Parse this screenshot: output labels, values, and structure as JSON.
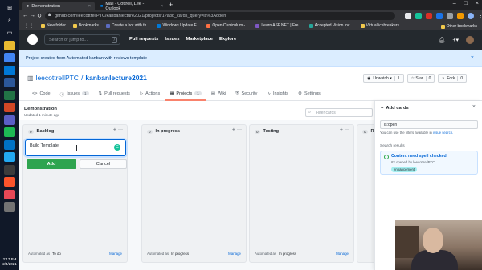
{
  "taskbar": {
    "icons": [
      {
        "name": "windows-start-icon",
        "color": "#101828",
        "glyph": "⊞"
      },
      {
        "name": "search-icon",
        "color": "#101828",
        "glyph": "⌕"
      },
      {
        "name": "task-view-icon",
        "color": "#101828",
        "glyph": "▭"
      },
      {
        "name": "file-explorer-icon",
        "color": "#e8b931",
        "glyph": ""
      },
      {
        "name": "chrome-icon",
        "color": "#4285f4",
        "glyph": ""
      },
      {
        "name": "edge-icon",
        "color": "#0078d7",
        "glyph": ""
      },
      {
        "name": "word-icon",
        "color": "#2b579a",
        "glyph": ""
      },
      {
        "name": "excel-icon",
        "color": "#217346",
        "glyph": ""
      },
      {
        "name": "powerpoint-icon",
        "color": "#d24726",
        "glyph": ""
      },
      {
        "name": "teams-icon",
        "color": "#5b5fc7",
        "glyph": ""
      },
      {
        "name": "spotify-icon",
        "color": "#1db954",
        "glyph": ""
      },
      {
        "name": "outlook-icon",
        "color": "#0072c6",
        "glyph": ""
      },
      {
        "name": "vscode-icon",
        "color": "#23a9f2",
        "glyph": ""
      },
      {
        "name": "terminal-icon",
        "color": "#3c3c3c",
        "glyph": ""
      },
      {
        "name": "brave-icon",
        "color": "#fb542b",
        "glyph": ""
      },
      {
        "name": "app-icon",
        "color": "#e74856",
        "glyph": ""
      },
      {
        "name": "settings-icon",
        "color": "#737373",
        "glyph": ""
      }
    ],
    "time": "2:17 PM",
    "date": "2/4/2021"
  },
  "browser": {
    "tabs": [
      {
        "title": "Demonstration",
        "active": true,
        "close": "×"
      },
      {
        "title": "Mail - Cottrell, Lee - Outlook",
        "active": false,
        "close": "×"
      }
    ],
    "new_tab": "+",
    "address": "github.com/leecottrellPTC/kanbanlecture2021/projects/1?add_cards_query=is%3Aopen",
    "bookmarks": [
      {
        "label": "New folder",
        "color": "#f2c94c"
      },
      {
        "label": "Bookmarks",
        "color": "#f2c94c"
      },
      {
        "label": "Create a bot with th...",
        "color": "#5c6bc0"
      },
      {
        "label": "Windows Update F...",
        "color": "#0078d7"
      },
      {
        "label": "Open Curriculum -...",
        "color": "#ff7043"
      },
      {
        "label": "Learn ASP.NET | Fre...",
        "color": "#7e57c2"
      },
      {
        "label": "Accepted Vision Inc...",
        "color": "#26a69a"
      },
      {
        "label": "Virtual icebreakers",
        "color": "#f2c94c"
      }
    ],
    "other_bookmarks": "Other bookmarks"
  },
  "github": {
    "search_placeholder": "Search or jump to...",
    "search_key": "/",
    "nav": [
      "Pull requests",
      "Issues",
      "Marketplace",
      "Explore"
    ],
    "flash": "Project created from Automated kanban with reviews template",
    "owner": "leecottrellPTC",
    "separator": "/",
    "repo": "kanbanlecture2021",
    "actions": [
      {
        "label": "Unwatch ▾",
        "count": "1"
      },
      {
        "label": "☆ Star",
        "count": "0"
      },
      {
        "label": "Fork",
        "count": "0"
      }
    ],
    "tabs": [
      {
        "label": "Code",
        "icon": "<>",
        "badge": ""
      },
      {
        "label": "Issues",
        "icon": "ⓘ",
        "badge": "1"
      },
      {
        "label": "Pull requests",
        "icon": "⇅",
        "badge": ""
      },
      {
        "label": "Actions",
        "icon": "▷",
        "badge": ""
      },
      {
        "label": "Projects",
        "icon": "▦",
        "badge": "1"
      },
      {
        "label": "Wiki",
        "icon": "▤",
        "badge": ""
      },
      {
        "label": "Security",
        "icon": "⛨",
        "badge": ""
      },
      {
        "label": "Insights",
        "icon": "∿",
        "badge": ""
      },
      {
        "label": "Settings",
        "icon": "⚙",
        "badge": ""
      }
    ]
  },
  "project": {
    "name": "Demonstration",
    "updated": "Updated 1 minute ago",
    "filter_placeholder": "Filter cards",
    "columns": [
      {
        "name": "Backlog",
        "count": "0",
        "automated_label": "Automated as",
        "automated_value": "To do",
        "manage": "Manage"
      },
      {
        "name": "In progress",
        "count": "0",
        "automated_label": "Automated as",
        "automated_value": "In progress",
        "manage": "Manage"
      },
      {
        "name": "Testing",
        "count": "0",
        "automated_label": "Automated as",
        "automated_value": "In progress",
        "manage": "Manage"
      },
      {
        "name": "R",
        "count": "0",
        "automated_label": "",
        "automated_value": "",
        "manage": ""
      }
    ],
    "note_text": "Build Template",
    "add_button": "Add",
    "cancel_button": "Cancel"
  },
  "add_cards": {
    "title": "Add cards",
    "query": "is:open",
    "hint_prefix": "You can use the filters available in",
    "hint_link": "issue search.",
    "results_label": "Search results",
    "result": {
      "title": "Content need spell checked",
      "meta": "#2 opened by leecottrellPTC",
      "label": "enhancement"
    }
  }
}
